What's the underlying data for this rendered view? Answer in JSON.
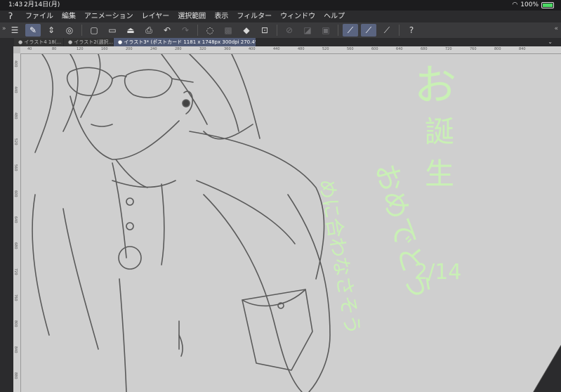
{
  "status": {
    "time": "1:43",
    "date": "2月14日(月)",
    "battery": "100%"
  },
  "menu": {
    "items": [
      "ファイル",
      "編集",
      "アニメーション",
      "レイヤー",
      "選択範囲",
      "表示",
      "フィルター",
      "ウィンドウ",
      "ヘルプ"
    ]
  },
  "tabs": [
    {
      "label": "● イラスト4 18(..."
    },
    {
      "label": "● イラスト2(選択..."
    },
    {
      "label": "● イラスト3* (ポストカード 1181 x 1748px 300dpi 270.4%)"
    }
  ],
  "ruler": {
    "h_labels": [
      "40",
      "80",
      "120",
      "160",
      "200",
      "240",
      "280",
      "320",
      "360",
      "400",
      "440",
      "480",
      "520",
      "560",
      "600",
      "640",
      "680",
      "720",
      "760",
      "800",
      "840"
    ],
    "v_labels": [
      "400",
      "440",
      "480",
      "520",
      "560",
      "600",
      "640",
      "680",
      "720",
      "760",
      "800",
      "840",
      "880"
    ]
  },
  "artwork": {
    "line1": "お誕生",
    "line2": "おめでとう",
    "date": "2/14",
    "name": "めに合わなさそう"
  },
  "colors": {
    "text_accent": "#c9f0b5",
    "canvas": "#cfcfcf",
    "active_tool": "#5a6480"
  }
}
